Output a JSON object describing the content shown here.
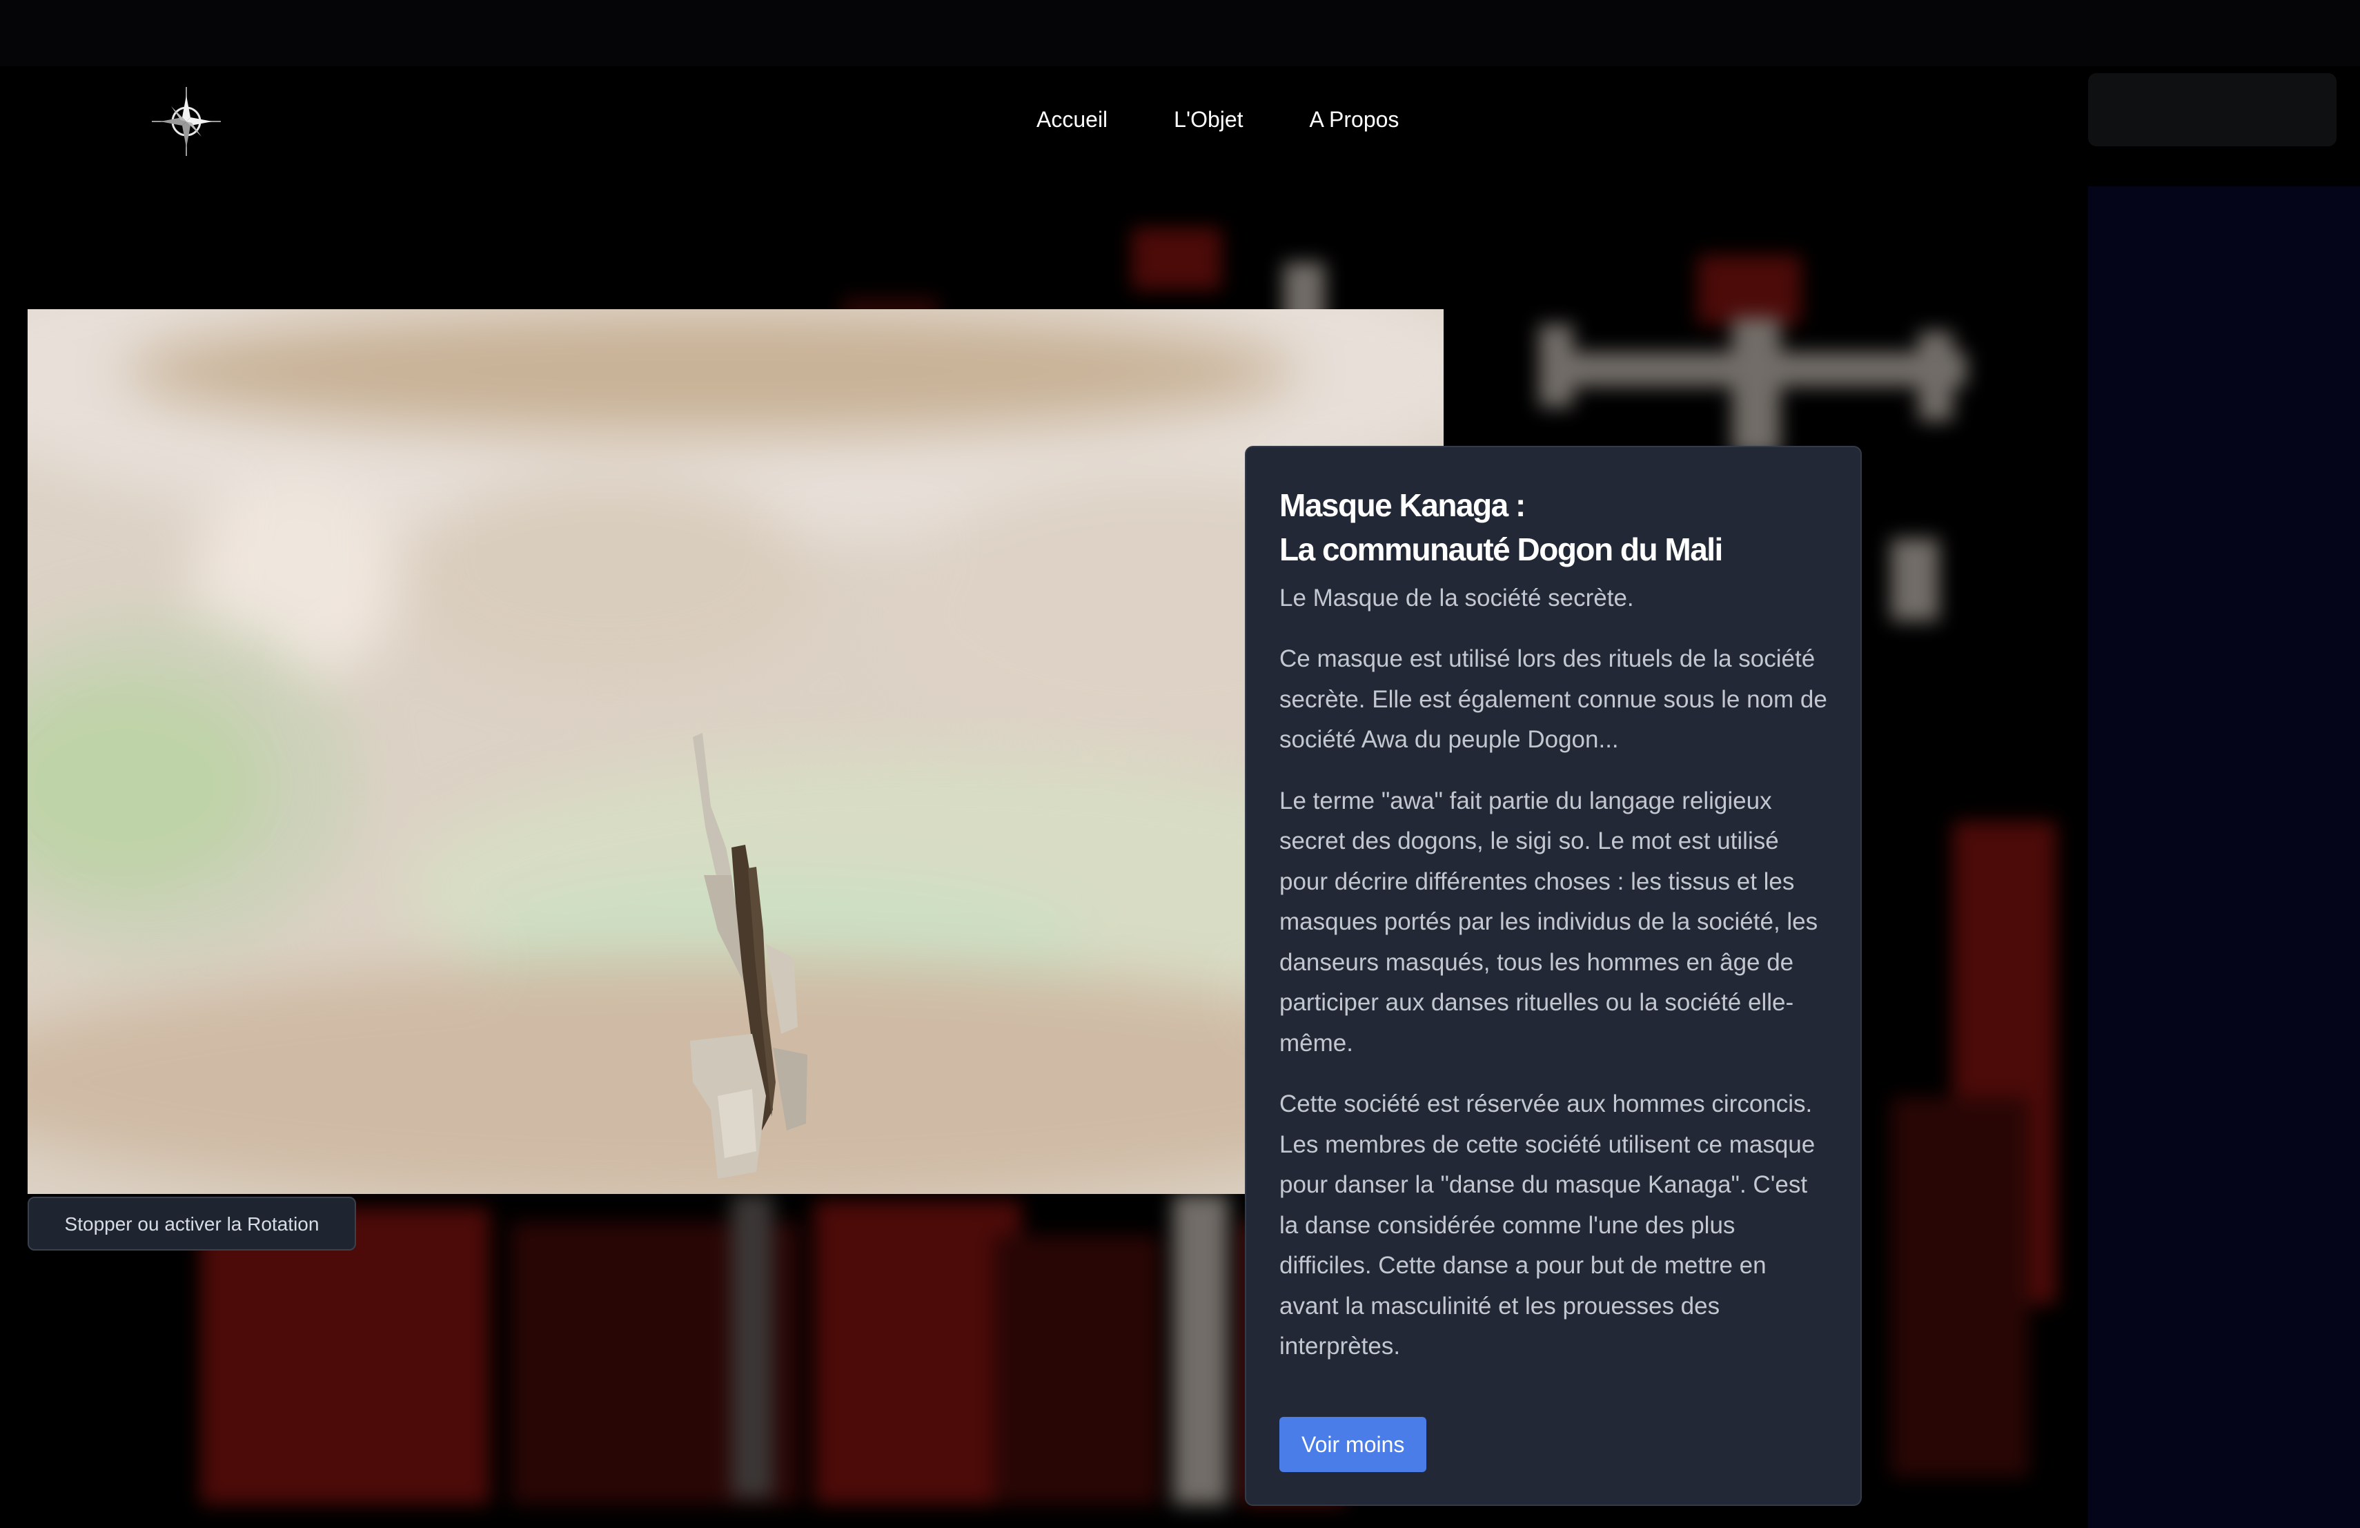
{
  "nav": {
    "items": [
      {
        "label": "Accueil"
      },
      {
        "label": "L'Objet"
      },
      {
        "label": "A Propos"
      }
    ]
  },
  "viewer": {
    "rotate_button_label": "Stopper ou activer la Rotation"
  },
  "card": {
    "title_line1": "Masque Kanaga :",
    "title_line2": "La communauté Dogon du Mali",
    "subtitle": "Le Masque de la société secrète.",
    "paragraphs": [
      "Ce masque est utilisé lors des rituels de la société secrète. Elle est également connue sous le nom de société Awa du peuple Dogon...",
      "Le terme \"awa\" fait partie du langage religieux secret des dogons, le sigi so. Le mot est utilisé pour décrire différentes choses : les tissus et les masques portés par les individus de la société, les danseurs masqués, tous les hommes en âge de participer aux danses rituelles ou la société elle-même.",
      "Cette société est réservée aux hommes circoncis. Les membres de cette société utilisent ce masque pour danser la \"danse du masque Kanaga\". C'est la danse considérée comme l'une des plus difficiles. Cette danse a pour but de mettre en avant la masculinité et les prouesses des interprètes."
    ],
    "toggle_button_label": "Voir moins"
  },
  "icons": {
    "logo": "compass-rose-icon"
  },
  "colors": {
    "page_background": "#000000",
    "card_background": "#222835",
    "accent_button": "#4a7de8",
    "rotate_button": "#1f2530"
  }
}
